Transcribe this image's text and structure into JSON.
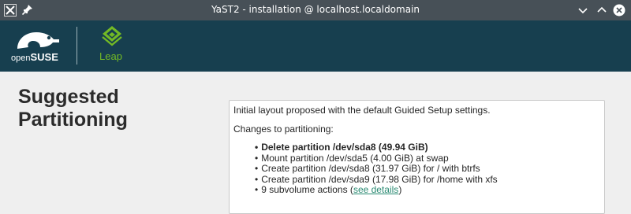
{
  "window": {
    "title": "YaST2 - installation @ localhost.localdomain",
    "app_icon": "x-app-icon",
    "pin_icon": "pin-icon",
    "controls": [
      "minimize-icon",
      "maximize-icon",
      "close-icon"
    ]
  },
  "banner": {
    "opensuse_logo": {
      "prefix": "open",
      "name": "SUSE"
    },
    "leap_logo": {
      "label": "Leap"
    },
    "colors": {
      "background": "#173f4f",
      "accent": "#73ba25"
    }
  },
  "page": {
    "title_line1": "Suggested",
    "title_line2": "Partitioning"
  },
  "summary": {
    "intro": "Initial layout proposed with the default Guided Setup settings.",
    "changes_heading": "Changes to partitioning:",
    "items": [
      {
        "text": "Delete partition /dev/sda8 (49.94 GiB)",
        "bold": true
      },
      {
        "text": "Mount partition /dev/sda5 (4.00 GiB) at swap",
        "bold": false
      },
      {
        "text": "Create partition /dev/sda8 (31.97 GiB) for / with btrfs",
        "bold": false
      },
      {
        "text": "Create partition /dev/sda9 (17.98 GiB) for /home with xfs",
        "bold": false
      },
      {
        "text_before": "9 subvolume actions (",
        "link": "see details",
        "text_after": ")",
        "bold": false
      }
    ]
  }
}
